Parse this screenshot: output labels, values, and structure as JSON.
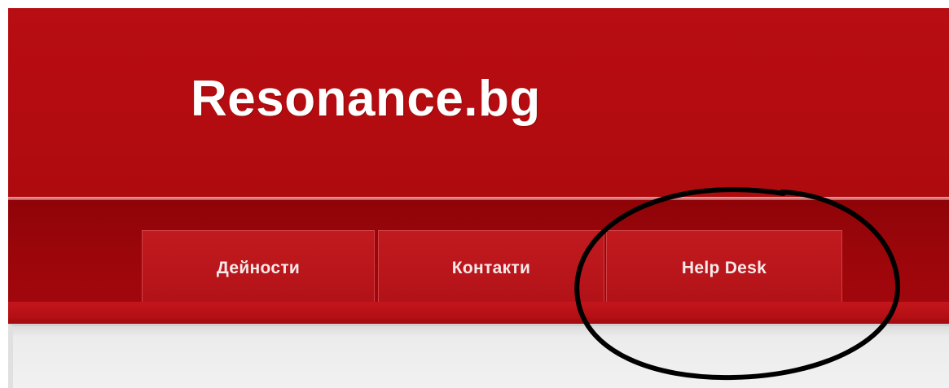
{
  "site": {
    "title": "Resonance.bg"
  },
  "nav": {
    "tabs": [
      {
        "label": "Дейности"
      },
      {
        "label": "Контакти"
      },
      {
        "label": "Help Desk"
      }
    ]
  },
  "colors": {
    "header_red": "#b30c10",
    "nav_dark_red": "#9c060b",
    "tab_red": "#b9161b",
    "content_gray": "#f1f1f1",
    "annotation_ink": "#000000"
  },
  "annotation": {
    "shape": "hand-drawn ellipse",
    "highlights": "Help Desk tab"
  }
}
